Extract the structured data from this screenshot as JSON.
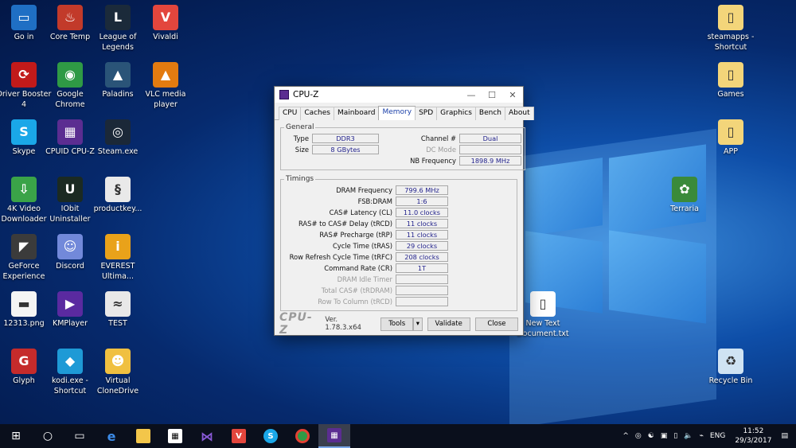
{
  "desktop_icons": [
    {
      "label": "Go in",
      "color": "#1f6fc4",
      "glyph": "▭"
    },
    {
      "label": "Core Temp",
      "color": "#c23a2a",
      "glyph": "♨"
    },
    {
      "label": "League of Legends",
      "color": "#1b2a3a",
      "glyph": "L"
    },
    {
      "label": "Vivaldi",
      "color": "#e3463d",
      "glyph": "V"
    },
    {
      "label": "Driver Booster 4",
      "color": "#c21a1a",
      "glyph": "⟳"
    },
    {
      "label": "Google Chrome",
      "color": "#2f9a45",
      "glyph": "◉"
    },
    {
      "label": "Paladins",
      "color": "#2a5478",
      "glyph": "▲"
    },
    {
      "label": "VLC media player",
      "color": "#e37b10",
      "glyph": "▲"
    },
    {
      "label": "Skype",
      "color": "#1aa7e8",
      "glyph": "S"
    },
    {
      "label": "CPUID CPU-Z",
      "color": "#5b2d91",
      "glyph": "▦"
    },
    {
      "label": "Steam.exe",
      "color": "#1b2838",
      "glyph": "◎"
    },
    {
      "label": "4K Video Downloader",
      "color": "#3aa348",
      "glyph": "⇩"
    },
    {
      "label": "IObit Uninstaller",
      "color": "#1b2a22",
      "glyph": "U"
    },
    {
      "label": "productkey...",
      "color": "#e9e9e9",
      "glyph": "§"
    },
    {
      "label": "GeForce Experience",
      "color": "#3b3b3b",
      "glyph": "◤"
    },
    {
      "label": "Discord",
      "color": "#7289da",
      "glyph": "☺"
    },
    {
      "label": "EVEREST Ultima...",
      "color": "#e9a21a",
      "glyph": "i"
    },
    {
      "label": "12313.png",
      "color": "#f4f4f4",
      "glyph": "▬"
    },
    {
      "label": "KMPlayer",
      "color": "#5a2aa0",
      "glyph": "▶"
    },
    {
      "label": "TEST",
      "color": "#e8e8e8",
      "glyph": "≈"
    },
    {
      "label": "Glyph",
      "color": "#c52b2b",
      "glyph": "G"
    },
    {
      "label": "kodi.exe - Shortcut",
      "color": "#1e9ad6",
      "glyph": "◆"
    },
    {
      "label": "Virtual CloneDrive",
      "color": "#f0c040",
      "glyph": "☻"
    },
    {
      "label": "steamapps - Shortcut",
      "color": "#f3d57a",
      "glyph": "▯"
    },
    {
      "label": "Games",
      "color": "#f3d57a",
      "glyph": "▯"
    },
    {
      "label": "APP",
      "color": "#f3d57a",
      "glyph": "▯"
    },
    {
      "label": "Terraria",
      "color": "#3a8a3a",
      "glyph": "✿"
    },
    {
      "label": "New Text Document.txt",
      "color": "#ffffff",
      "glyph": "▯"
    },
    {
      "label": "Recycle Bin",
      "color": "#cfe3f3",
      "glyph": "♻"
    }
  ],
  "window": {
    "title": "CPU-Z",
    "tabs": [
      "CPU",
      "Caches",
      "Mainboard",
      "Memory",
      "SPD",
      "Graphics",
      "Bench",
      "About"
    ],
    "active_tab": "Memory",
    "general": {
      "legend": "General",
      "type_label": "Type",
      "type_value": "DDR3",
      "size_label": "Size",
      "size_value": "8 GBytes",
      "channel_label": "Channel #",
      "channel_value": "Dual",
      "dcmode_label": "DC Mode",
      "dcmode_value": "",
      "nbfreq_label": "NB Frequency",
      "nbfreq_value": "1898.9 MHz"
    },
    "timings": {
      "legend": "Timings",
      "rows": [
        {
          "label": "DRAM Frequency",
          "value": "799.6 MHz",
          "enabled": true
        },
        {
          "label": "FSB:DRAM",
          "value": "1:6",
          "enabled": true
        },
        {
          "label": "CAS# Latency (CL)",
          "value": "11.0 clocks",
          "enabled": true
        },
        {
          "label": "RAS# to CAS# Delay (tRCD)",
          "value": "11 clocks",
          "enabled": true
        },
        {
          "label": "RAS# Precharge (tRP)",
          "value": "11 clocks",
          "enabled": true
        },
        {
          "label": "Cycle Time (tRAS)",
          "value": "29 clocks",
          "enabled": true
        },
        {
          "label": "Row Refresh Cycle Time (tRFC)",
          "value": "208 clocks",
          "enabled": true
        },
        {
          "label": "Command Rate (CR)",
          "value": "1T",
          "enabled": true
        },
        {
          "label": "DRAM Idle Timer",
          "value": "",
          "enabled": false
        },
        {
          "label": "Total CAS# (tRDRAM)",
          "value": "",
          "enabled": false
        },
        {
          "label": "Row To Column (tRCD)",
          "value": "",
          "enabled": false
        }
      ]
    },
    "brand": "CPU-Z",
    "version": "Ver. 1.78.3.x64",
    "tools_label": "Tools",
    "validate_label": "Validate",
    "close_label": "Close"
  },
  "taskbar": {
    "language": "ENG",
    "time": "11:52",
    "date": "29/3/2017"
  }
}
